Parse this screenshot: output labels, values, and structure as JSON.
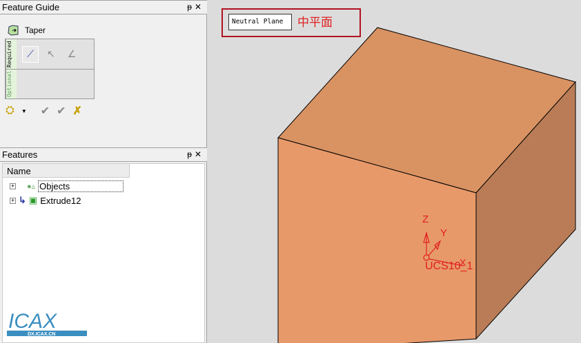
{
  "feature_guide": {
    "title": "Feature Guide",
    "pin": "ᵽ",
    "close": "✕",
    "feature_name": "Taper",
    "required_label": "Required",
    "optional_label": "Optional"
  },
  "features": {
    "title": "Features",
    "pin": "ᵽ",
    "close": "✕",
    "column_name": "Name",
    "items": [
      {
        "label": "Objects"
      },
      {
        "label": "Extrude12"
      }
    ]
  },
  "viewport": {
    "hint_box": "Neutral Plane",
    "hint_chinese": "中平面",
    "ucs": {
      "label": "UCS10_1",
      "x": "X",
      "y": "Y",
      "z": "Z"
    }
  },
  "watermark": {
    "logo": "ICAX",
    "url": "DX.ICAX.CN"
  },
  "colors": {
    "front": "#e8996a",
    "top": "#d99262",
    "right": "#b97c56",
    "accent": "#e02020"
  }
}
